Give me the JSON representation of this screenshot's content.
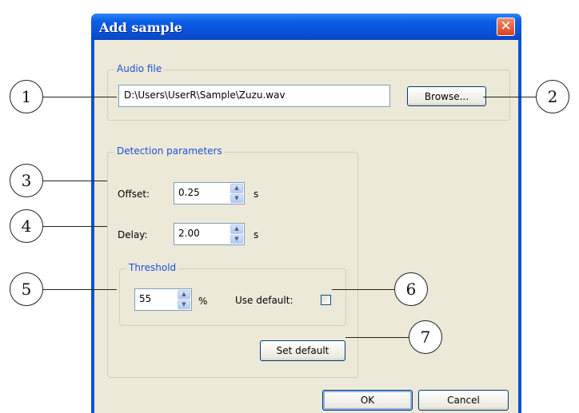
{
  "window": {
    "title": "Add sample",
    "close_glyph": "✕"
  },
  "audio_file": {
    "legend": "Audio file",
    "path_value": "D:\\Users\\UserR\\Sample\\Zuzu.wav",
    "browse_label": "Browse..."
  },
  "detection": {
    "legend": "Detection parameters",
    "offset_label": "Offset:",
    "offset_value": "0.25",
    "offset_unit": "s",
    "delay_label": "Delay:",
    "delay_value": "2.00",
    "delay_unit": "s",
    "threshold": {
      "legend": "Threshold",
      "value": "55",
      "unit": "%",
      "use_default_label": "Use default:",
      "use_default_checked": false
    },
    "set_default_label": "Set default"
  },
  "footer": {
    "ok_label": "OK",
    "cancel_label": "Cancel"
  },
  "spin_icons": {
    "up": "▲",
    "down": "▼"
  },
  "callouts": [
    "1",
    "2",
    "3",
    "4",
    "5",
    "6",
    "7"
  ]
}
